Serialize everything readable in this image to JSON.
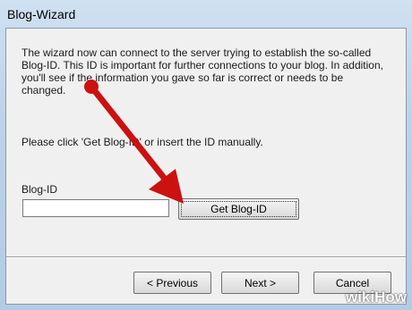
{
  "window": {
    "title": "Blog-Wizard"
  },
  "body": {
    "description": "The wizard now can connect to the server trying to establish the so-called Blog-ID. This ID is important for further connections to your blog. In addition, you'll see if the information you gave so far is correct or needs to be changed.",
    "instruction": "Please click 'Get Blog-ID' or insert the ID manually.",
    "field_label": "Blog-ID",
    "field_value": "",
    "get_id_button": "Get Blog-ID"
  },
  "footer": {
    "previous_button": "< Previous",
    "next_button": "Next >",
    "cancel_button": "Cancel"
  },
  "overlay": {
    "arrow_color": "#cc1111",
    "watermark": "wikiHow"
  }
}
